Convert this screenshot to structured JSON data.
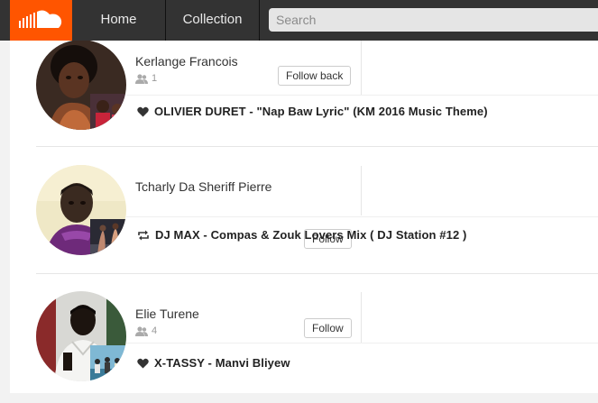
{
  "header": {
    "nav": {
      "home": "Home",
      "collection": "Collection"
    },
    "search": {
      "placeholder": "Search"
    },
    "brand_color": "#ff5500",
    "bar_color": "#333333"
  },
  "feed": [
    {
      "user": "Kerlange Francois",
      "followers": "1",
      "button": "Follow back",
      "action_icon": "heart-icon",
      "track": "OLIVIER DURET - \"Nap Baw Lyric\" (KM 2016 Music Theme)"
    },
    {
      "user": "Tcharly Da Sheriff Pierre",
      "followers": "",
      "button": "Follow",
      "action_icon": "repost-icon",
      "track": "DJ MAX - Compas & Zouk Lovers Mix ( DJ Station #12 )"
    },
    {
      "user": "Elie Turene",
      "followers": "4",
      "button": "Follow",
      "action_icon": "heart-icon",
      "track": "X-TASSY - Manvi Bliyew"
    }
  ]
}
